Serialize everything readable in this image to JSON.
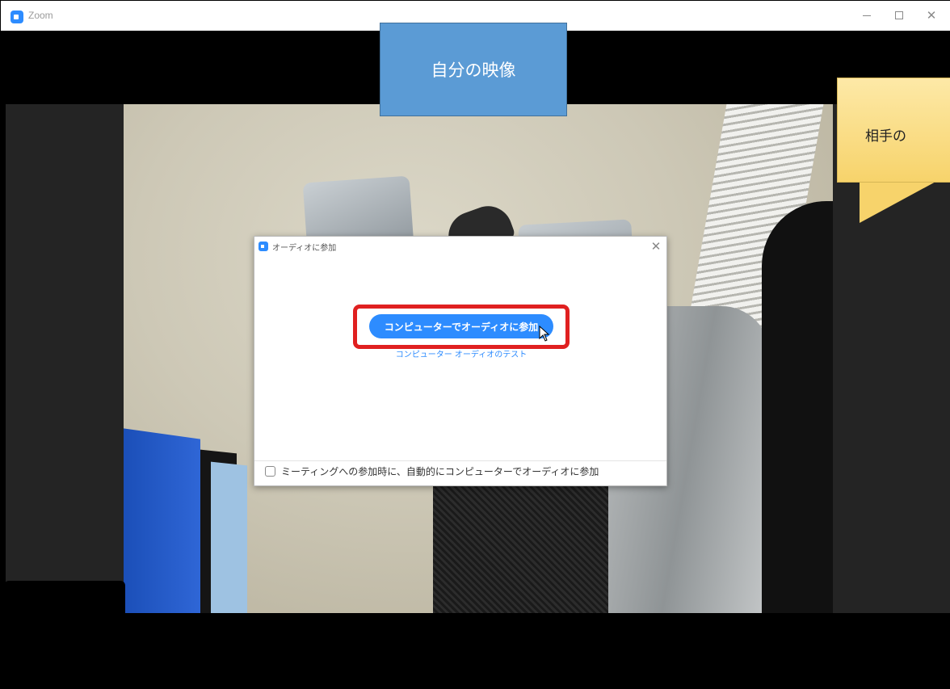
{
  "window": {
    "app_title": "Zoom",
    "minimize_glyph": "−",
    "close_glyph": "✕"
  },
  "annotations": {
    "self_video": "自分の映像",
    "other_video": "相手の"
  },
  "dialog": {
    "title": "オーディオに参加",
    "close_glyph": "✕",
    "join_button_label": "コンピューターでオーディオに参加",
    "test_link_label": "コンピューター オーディオのテスト",
    "auto_join_label": "ミーティングへの参加時に、自動的にコンピューターでオーディオに参加",
    "auto_join_checked": false
  },
  "colors": {
    "zoom_blue": "#2d8cff",
    "highlight_red": "#e02020",
    "callout_blue": "#5b9bd5",
    "callout_yellow": "#f7d36b"
  },
  "icons": {
    "app_logo": "zoom-camera-icon",
    "cursor": "mouse-pointer-icon"
  }
}
